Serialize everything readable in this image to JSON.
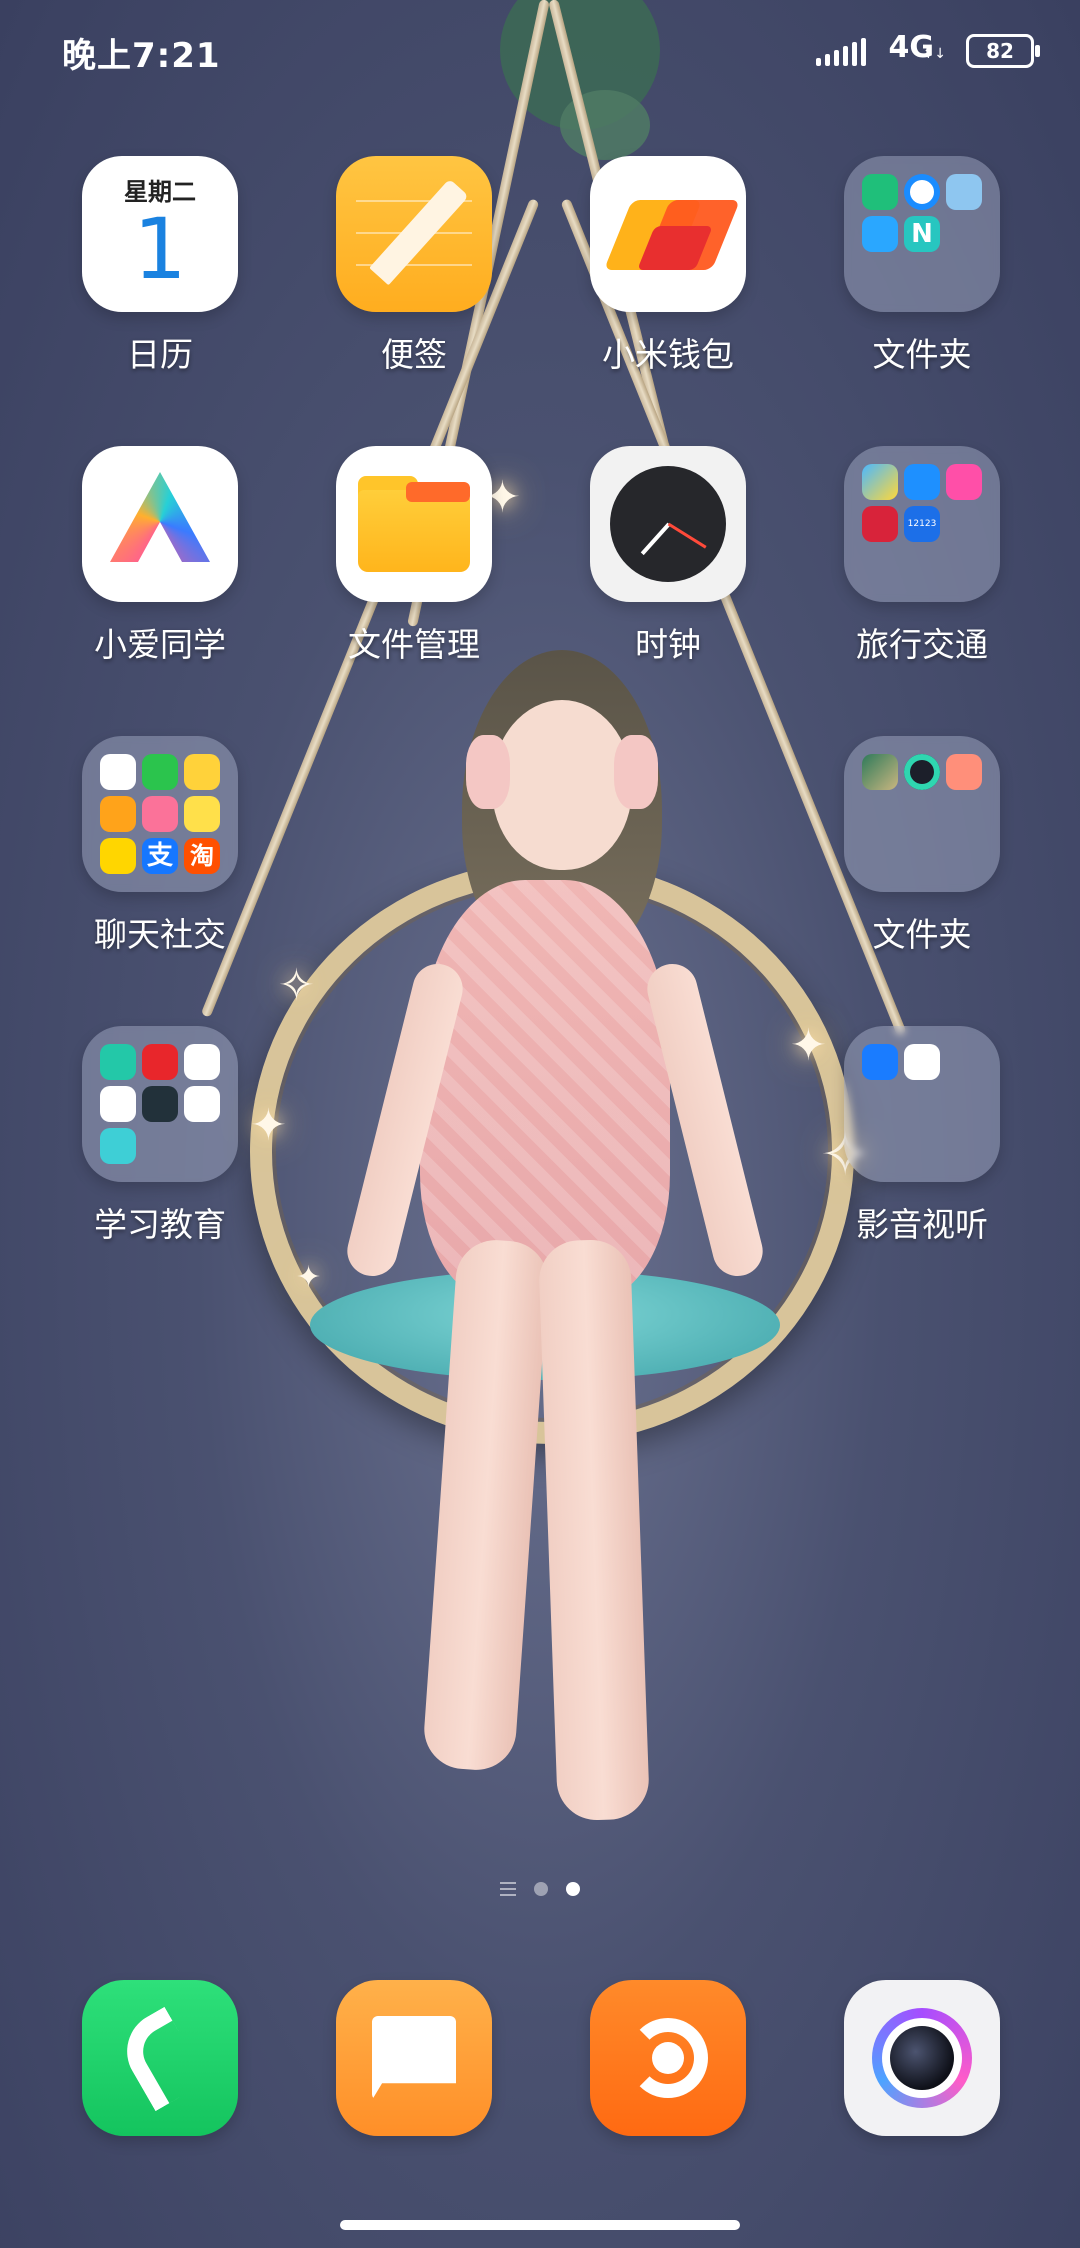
{
  "status_bar": {
    "time": "晚上7:21",
    "network": "4G",
    "battery": "82"
  },
  "apps": [
    {
      "label": "日历",
      "calendar_weekday": "星期二",
      "calendar_day": "1"
    },
    {
      "label": "便签"
    },
    {
      "label": "小米钱包"
    },
    {
      "label": "文件夹"
    },
    {
      "label": "小爱同学"
    },
    {
      "label": "文件管理"
    },
    {
      "label": "时钟"
    },
    {
      "label": "旅行交通",
      "mini_text": "12123"
    },
    {
      "label": "聊天社交"
    },
    {
      "label": "文件夹"
    },
    {
      "label": "学习教育"
    },
    {
      "label": "影音视听"
    }
  ],
  "folder_mini_glyphs": {
    "alipay": "支",
    "taobao": "淘",
    "note": "N"
  },
  "page_indicator": {
    "pages": 2,
    "active": 2
  },
  "dock": [
    {
      "name": "phone"
    },
    {
      "name": "messages"
    },
    {
      "name": "uc-browser"
    },
    {
      "name": "camera"
    }
  ]
}
